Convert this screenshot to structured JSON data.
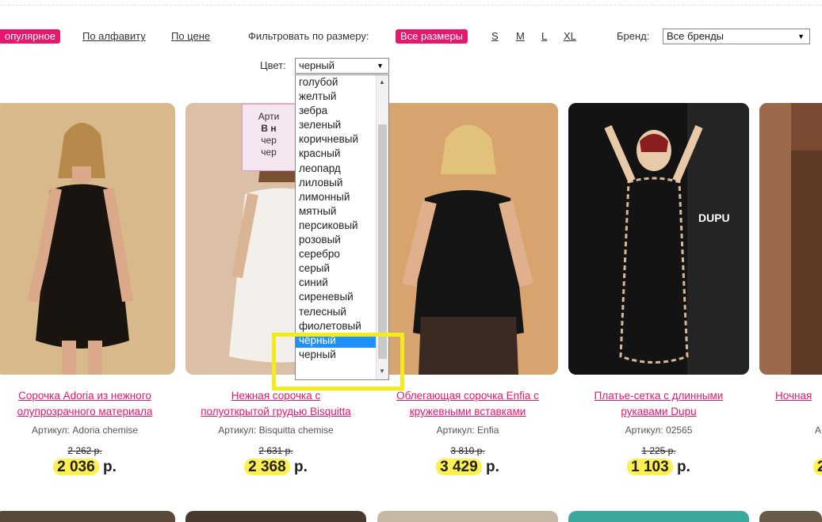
{
  "sort": {
    "active": "Популярное",
    "active_visible": "опулярное",
    "options": [
      "По алфавиту",
      "По цене"
    ]
  },
  "size_filter": {
    "label": "Фильтровать по размеру:",
    "active": "Все размеры",
    "sizes": [
      "S",
      "M",
      "L",
      "XL"
    ]
  },
  "brand_filter": {
    "label": "Бренд:",
    "selected": "Все бренды"
  },
  "color_filter": {
    "label": "Цвет:",
    "selected": "черный",
    "options": [
      "голубой",
      "желтый",
      "зебра",
      "зеленый",
      "коричневый",
      "красный",
      "леопард",
      "лиловый",
      "лимонный",
      "мятный",
      "персиковый",
      "розовый",
      "серебро",
      "серый",
      "синий",
      "сиреневый",
      "телесный",
      "фиолетовый",
      "чёрный",
      "черный"
    ],
    "highlighted": "чёрный"
  },
  "badge": {
    "line1": "Арти",
    "line2": "В н",
    "line3": "чер",
    "line4": "чер"
  },
  "products": [
    {
      "title": "Сорочка Adoria из нежного полупрозрачного материала",
      "title_l1": "Сорочка Adoria из нежного",
      "title_l2": "олупрозрачного материала",
      "sku": "Артикул: Adoria chemise",
      "old_price": "2 262 р.",
      "price": "2 036",
      "currency": "р."
    },
    {
      "title": "Нежная сорочка с полуоткрытой грудью Bisquitta",
      "title_l1": "Нежная сорочка с",
      "title_l2": "полуоткрытой грудью Bisquitta",
      "sku": "Артикул: Bisquitta chemise",
      "old_price": "2 631 р.",
      "price": "2 368",
      "currency": "р."
    },
    {
      "title": "Облегающая сорочка Enfia с кружевными вставками",
      "title_l1": "Облегающая сорочка Enfia с",
      "title_l2": "кружевными вставками",
      "sku": "Артикул: Enfia",
      "old_price": "3 810 р.",
      "price": "3 429",
      "currency": "р."
    },
    {
      "title": "Платье-сетка с длинными рукавами Dupu",
      "title_l1": "Платье-сетка с длинными",
      "title_l2": "рукавами Dupu",
      "sku": "Артикул: 02565",
      "old_price": "1 225 р.",
      "price": "1 103",
      "currency": "р."
    },
    {
      "title": "Ночная",
      "title_l1": "Ночная",
      "title_l2": "",
      "sku": "А",
      "old_price": "",
      "price": "2",
      "currency": ""
    }
  ],
  "image_logo": "DUPU",
  "colors": {
    "accent": "#e8176c",
    "price_highlight": "#fdf050",
    "select_highlight": "#1e90ff",
    "annotation": "#f3ec19"
  }
}
